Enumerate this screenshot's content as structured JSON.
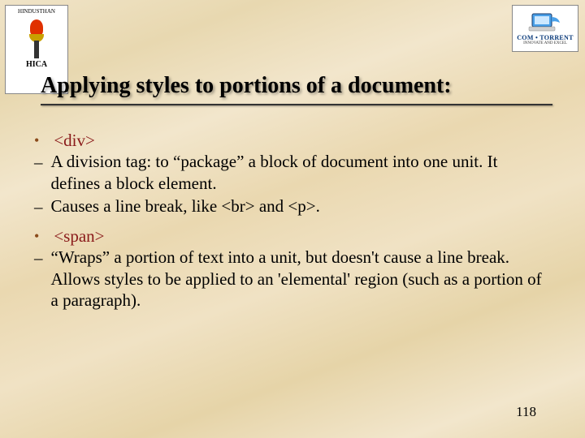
{
  "logo_left": {
    "top_text": "HINDUSTHAN",
    "name": "HICA"
  },
  "logo_right": {
    "brand": "COM • TORRENT",
    "tagline": "INNOVATE AND EXCEL"
  },
  "title": "Applying styles to portions of a document:",
  "bullets": [
    {
      "head": "<div>",
      "subs": [
        "A division tag: to “package” a block of document into one unit. It defines a block element.",
        "Causes a line break, like <br> and <p>."
      ]
    },
    {
      "head": "<span>",
      "subs": [
        "“Wraps” a portion of text into a unit, but doesn't cause a line break. Allows styles to be applied to an 'elemental' region (such as a portion of a paragraph)."
      ]
    }
  ],
  "page_number": "118"
}
